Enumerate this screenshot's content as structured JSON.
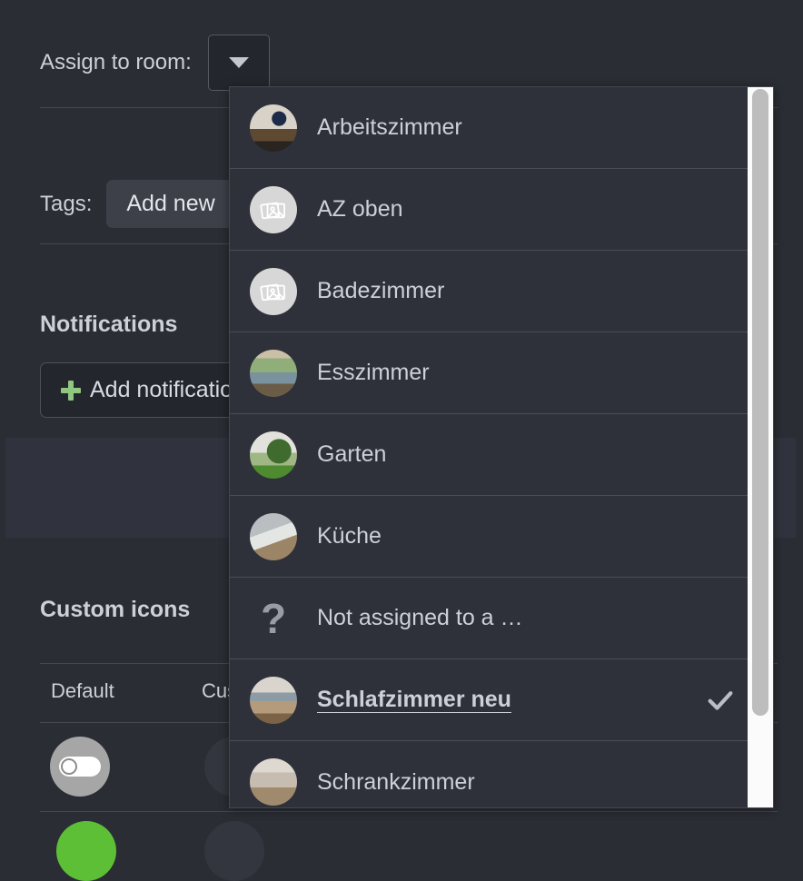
{
  "settings_page": {
    "assign_label": "Assign to room:",
    "select_icon": "chevron-down-icon",
    "tags_label": "Tags:",
    "tags_add_button": "Add new",
    "notifications_heading": "Notifications",
    "add_notification_button": "Add notification",
    "add_notification_icon": "plus-icon",
    "custom_icons_heading": "Custom icons",
    "table": {
      "columns": [
        "Default",
        "Custom"
      ],
      "rows": [
        {
          "default_icon": "toggle-off-icon",
          "custom_icon": "empty-icon"
        },
        {
          "default_icon": "green-circle-icon",
          "custom_icon": "empty-icon"
        }
      ]
    }
  },
  "dropdown": {
    "name": "assign-to-room-dropdown",
    "scrollbar": {
      "name": "dropdown-scrollbar",
      "thumb": "dropdown-scroll-thumb"
    },
    "items": [
      {
        "label": "Arbeitszimmer",
        "avatar": "photo-arbeitszimmer",
        "avatar_kind": "photo",
        "selected": false
      },
      {
        "label": "AZ oben",
        "avatar": "image-placeholder-icon",
        "avatar_kind": "placeholder",
        "selected": false
      },
      {
        "label": "Badezimmer",
        "avatar": "image-placeholder-icon",
        "avatar_kind": "placeholder",
        "selected": false
      },
      {
        "label": "Esszimmer",
        "avatar": "photo-esszimmer",
        "avatar_kind": "photo",
        "selected": false
      },
      {
        "label": "Garten",
        "avatar": "photo-garten",
        "avatar_kind": "photo",
        "selected": false
      },
      {
        "label": "Küche",
        "avatar": "photo-kueche",
        "avatar_kind": "photo",
        "selected": false
      },
      {
        "label": "Not assigned to a …",
        "avatar": "question-mark-icon",
        "avatar_kind": "question",
        "selected": false
      },
      {
        "label": "Schlafzimmer neu",
        "avatar": "photo-schlafzimmer",
        "avatar_kind": "photo",
        "selected": true
      },
      {
        "label": "Schrankzimmer",
        "avatar": "photo-schrankzimmer",
        "avatar_kind": "photo",
        "selected": false
      }
    ],
    "check_icon": "check-icon"
  },
  "colors": {
    "background": "#2b2d35",
    "panel": "#30333d",
    "dropdown_item": "#2e313a",
    "divider": "#4a4d56",
    "text": "#ccd0d8",
    "accent_green": "#8fc781",
    "status_green": "#5cbf35",
    "scrollbar_track": "#fbfbfb",
    "scrollbar_thumb": "#bdbdbd"
  }
}
